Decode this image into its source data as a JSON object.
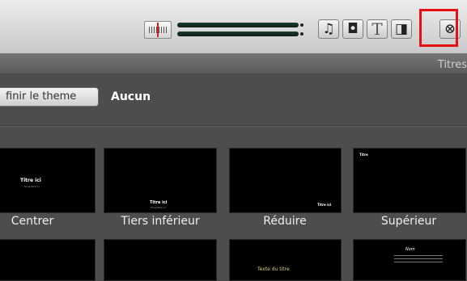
{
  "toolbar": {
    "buttons": [
      {
        "name": "music-icon",
        "glyph": "♫"
      },
      {
        "name": "camera-icon",
        "glyph": "◘"
      },
      {
        "name": "title-icon",
        "glyph": "T"
      },
      {
        "name": "transition-icon",
        "glyph": "◨"
      },
      {
        "name": "map-icon",
        "glyph": "⊗"
      }
    ],
    "highlight_color": "#e60f14"
  },
  "browser": {
    "panel_title": "Titres",
    "theme_button": "finir le theme",
    "theme_value": "Aucun"
  },
  "tiles": [
    {
      "label": "Centrer",
      "preview_title": "Titre ici",
      "preview_sub": "Sous-titre ici"
    },
    {
      "label": "Tiers inférieur",
      "preview_title": "Titre ici",
      "preview_sub": "Sous-titre ici"
    },
    {
      "label": "Réduire",
      "preview_title": "Titre ici"
    },
    {
      "label": "Supérieur",
      "preview_title": "Titre"
    },
    {
      "label": ""
    },
    {
      "label": ""
    },
    {
      "label": "",
      "preview_title": "Texte du titre"
    },
    {
      "label": "",
      "preview_title": "Nom"
    }
  ]
}
